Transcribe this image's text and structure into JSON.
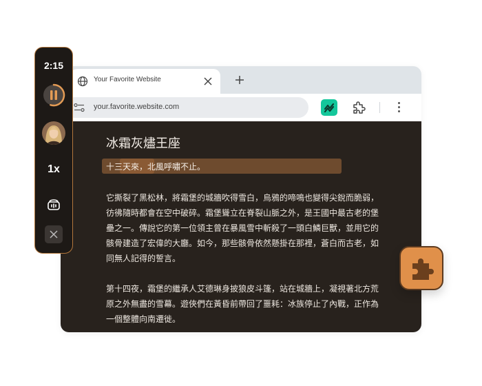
{
  "browser": {
    "tab": {
      "title": "Your Favorite Website"
    },
    "address_bar": {
      "url": "your.favorite.website.com"
    },
    "colors": {
      "content_bg": "#28221d",
      "tabbar_bg": "#dfe4e8",
      "extension_green": "#14c79b"
    }
  },
  "article": {
    "title": "冰霜灰燼王座",
    "highlighted_sentence": "十三天來，北風呼嘯不止。",
    "current_word": "十三天來",
    "paragraphs": [
      "它撕裂了黑松林，將霜堡的城牆吹得雪白，烏鴉的啼鳴也變得尖銳而脆弱，彷彿隨時都會在空中破碎。霜堡聳立在脊裂山脈之外，是王國中最古老的堡壘之一。傳說它的第一位領主曾在暴風雪中斬殺了一頭白鱗巨獸，並用它的骸骨建造了宏偉的大廳。如今，那些骸骨依然懸掛在那裡，蒼白而古老，如同無人記得的誓言。",
      "第十四夜，霜堡的繼承人艾德琳身披狼皮斗篷，站在城牆上，凝視著北方荒原之外無盡的雪幕。遊俠們在黃昏前帶回了噩耗：冰族停止了內戰，正作為一個整體向南遷徙。"
    ]
  },
  "player": {
    "time": "2:15",
    "progress": 0.55,
    "state": "playing",
    "speed": "1x",
    "accent_color": "#b3773c",
    "icons": [
      "pause-icon",
      "voice-avatar",
      "voice-settings-icon",
      "close-icon"
    ]
  },
  "floating_extension": {
    "icon": "puzzle-icon",
    "color": "#e0904a"
  }
}
